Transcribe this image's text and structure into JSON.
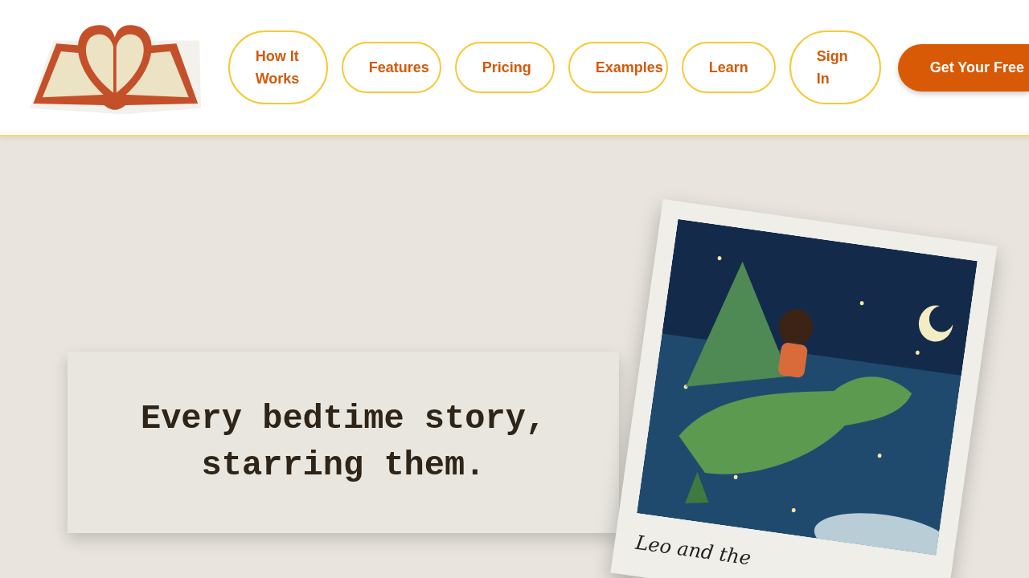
{
  "header": {
    "nav": [
      {
        "label": "How It Works",
        "kind": "link"
      },
      {
        "label": "Features",
        "kind": "link"
      },
      {
        "label": "Pricing",
        "kind": "link"
      },
      {
        "label": "Examples",
        "kind": "link"
      },
      {
        "label": "Learn",
        "kind": "link"
      },
      {
        "label": "Sign In",
        "kind": "link"
      },
      {
        "label": "Get Your Free",
        "kind": "cta"
      }
    ]
  },
  "hero": {
    "headline": "Every bedtime story, starring them.",
    "polaroid": {
      "caption": "Leo and the"
    }
  }
}
